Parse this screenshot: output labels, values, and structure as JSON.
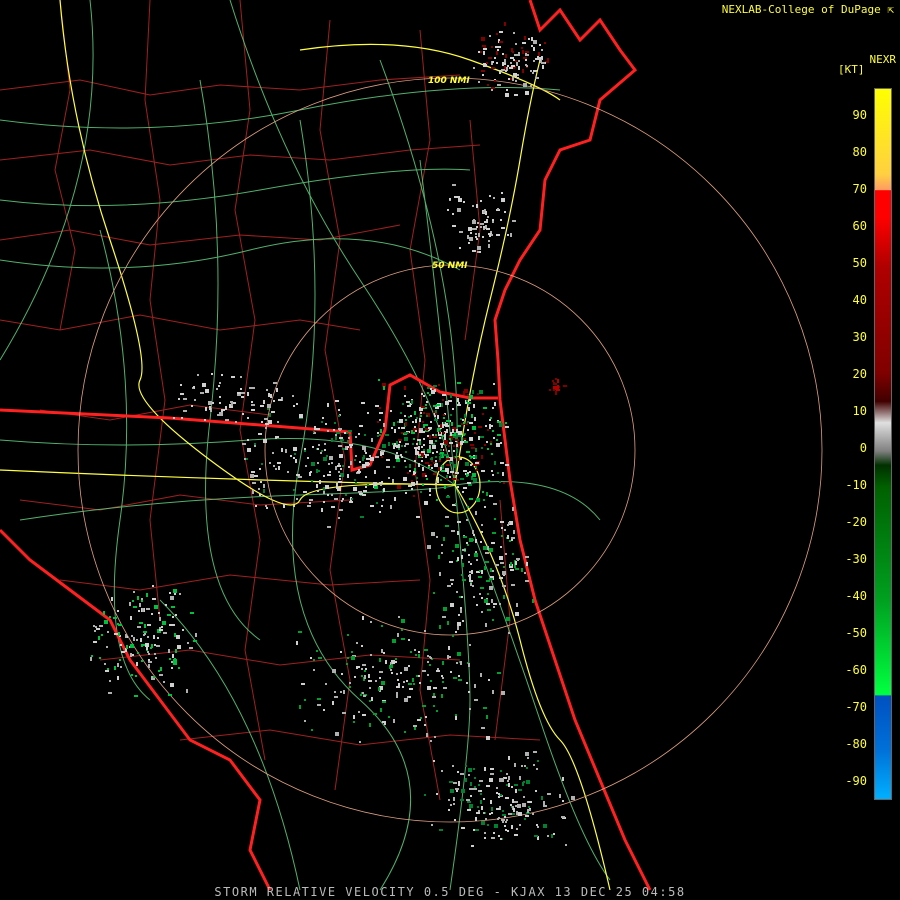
{
  "header": {
    "credit": "NEXLAB-College of DuPage",
    "credit_icon": "external-link-icon",
    "product": "NEXR",
    "units": "[KT]"
  },
  "rings": [
    {
      "label": "100 NMI"
    },
    {
      "label": "50 NMI"
    }
  ],
  "color_scale": {
    "ticks": [
      "90",
      "80",
      "70",
      "60",
      "50",
      "40",
      "30",
      "20",
      "10",
      "0",
      "-10",
      "-20",
      "-30",
      "-40",
      "-50",
      "-60",
      "-70",
      "-80",
      "-90"
    ],
    "colors": {
      "max_in": "#ffff00",
      "orange": "#ffa060",
      "red": "#ff0000",
      "dark_red": "#800000",
      "zero_white": "#e0e0e0",
      "dark_green": "#006000",
      "green": "#00ff40",
      "blue": "#0050c0",
      "light_blue": "#00b0ff"
    }
  },
  "map_colors": {
    "state_border": "#ff2020",
    "county_lines": "#a02020",
    "highways": "#ffff40",
    "roads": "#60d080",
    "range_rings": "#e0a080"
  },
  "caption": "STORM RELATIVE VELOCITY 0.5 DEG - KJAX 13 DEC 25 04:58"
}
